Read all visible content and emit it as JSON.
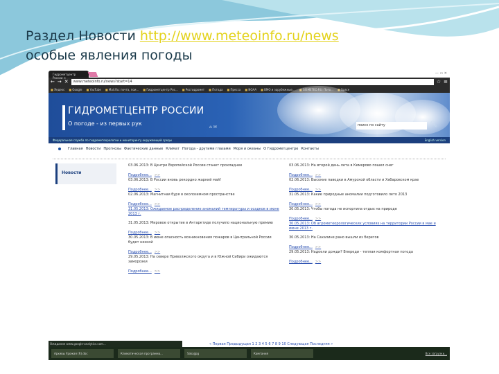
{
  "slide": {
    "title_prefix": "Раздел Новости ",
    "link": "http://www.meteoinfo.ru/news",
    "subtitle": "особые явления погоды"
  },
  "browser": {
    "tab": "Гидрометцентр России ×",
    "window_controls": "— ▭ ✕",
    "url": "www.meteoinfo.ru/news?start=14",
    "bookmarks": [
      "Яндекс",
      "Google",
      "YouTube",
      "Mail.Ru: почта, пои...",
      "Гидрометцентр Рос...",
      "Росгидромет",
      "Погода",
      "Пресса",
      "NOAA",
      "ВМО и зарубежные...",
      "GISMETEO.RU: Пого...",
      "Space"
    ]
  },
  "site": {
    "title": "ГИДРОМЕТЦЕНТР РОССИИ",
    "subtitle": "О погоде - из первых рук",
    "icons": "⌂ ✉",
    "search_placeholder": "поиск по сайту",
    "strip": "Федеральная служба по гидрометеорологии и мониторингу окружающей среды",
    "english": "English version",
    "menu": [
      "Главная",
      "Новости",
      "Прогнозы",
      "Фактические данные",
      "Климат",
      "Погода - другими глазами",
      "Моря и океаны",
      "О Гидрометцентре",
      "Контакты"
    ],
    "sidebar": "Новости",
    "more": "Подробнее...",
    "more_arrow": ">>",
    "col1": [
      {
        "text": "03.06.2013: В Центре Европейской России станет прохладнее",
        "more": true
      },
      {
        "text": "03.06.2013: В России вновь рекордно жаркий май!",
        "more": true
      },
      {
        "text": "02.06.2013: Магнитная буря в околоземном пространстве",
        "more": true
      },
      {
        "text": "31.05.2013: Ожидаемое распределение аномалий температуры и осадков в июне 2013 г.",
        "link": true
      },
      {
        "text": "31.05.2013: Мировое открытие в Антарктиде получило национальную премию",
        "more": true
      },
      {
        "text": "30.05.2013: В июне опасность возникновения пожаров в Центральной России будет низкой",
        "more": true
      },
      {
        "text": "29.05.2013: На севере Приволжского округа и в Южной Сибири ожидаются заморозки",
        "more": true
      }
    ],
    "col2": [
      {
        "text": "03.06.2013: На второй день лета в Кемерово пошел снег",
        "more": true
      },
      {
        "text": "02.06.2013: Высокие паводки в Амурской области и Хабаровском крае",
        "more": true
      },
      {
        "text": "31.05.2013: Какие природные аномалии подготовило лето 2013",
        "more": true
      },
      {
        "text": "30.05.2013: Чтобы погода не испортила отдых на природе",
        "more": true
      },
      {
        "text": "30.05.2013: Об агрометеорологических условиях на территории России в мае и июне 2013 г.",
        "link": true
      },
      {
        "text": "30.05.2013: На Сахалине рано вышли из берегов",
        "more": true
      },
      {
        "text": "29.05.2013: Надоели дожди? Впереди - теплая комфортная погода",
        "more": true
      }
    ],
    "pager": "« Первая Предыдущая 1 2 3 4 5 6 7 8 9 10 Следующая Последняя »"
  },
  "statusbar": "Ожидание www.google-analytics.com...",
  "downloads": [
    "Архивы Урожая (R).doc",
    "Климатическая программа...",
    "Sakajjpg",
    "Кампания"
  ],
  "all_downloads": "Все загрузки..."
}
